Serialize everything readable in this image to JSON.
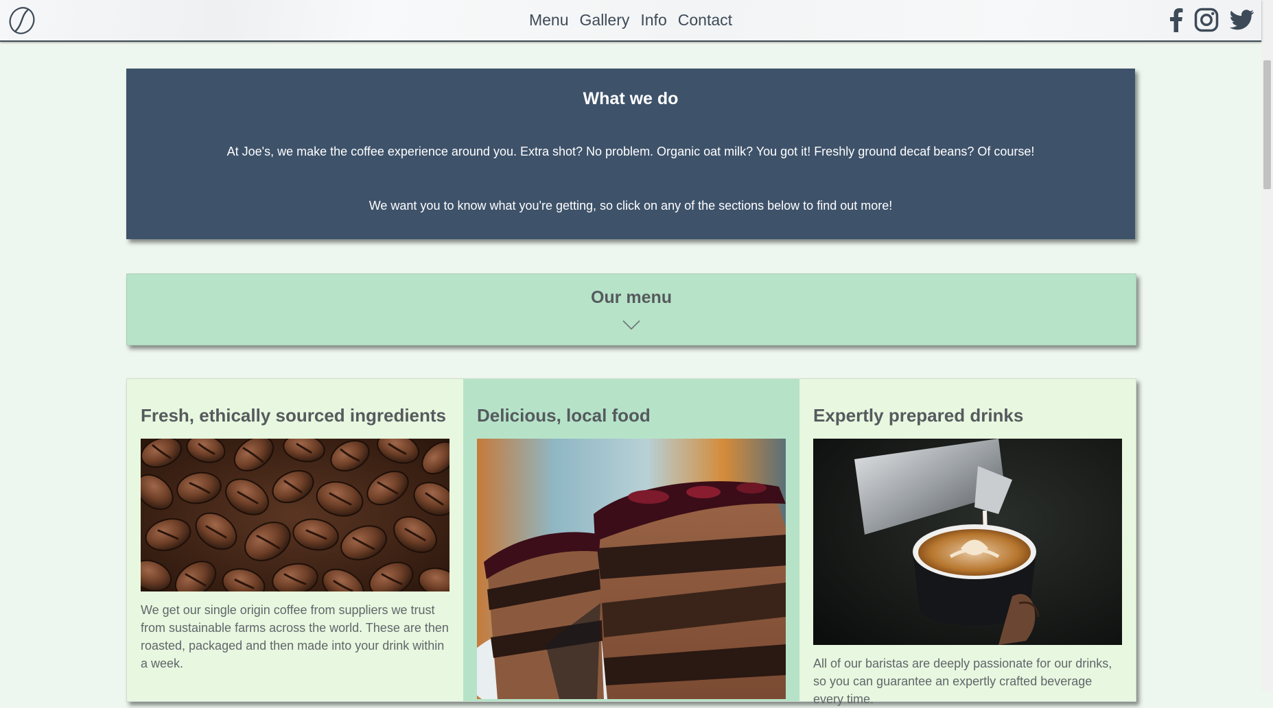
{
  "nav": {
    "logo_icon": "coffee-bean-logo-icon",
    "links": [
      {
        "label": "Menu"
      },
      {
        "label": "Gallery"
      },
      {
        "label": "Info"
      },
      {
        "label": "Contact"
      }
    ],
    "social_icons": [
      "facebook-icon",
      "instagram-icon",
      "twitter-icon"
    ]
  },
  "what_we_do": {
    "title": "What we do",
    "paragraphs": [
      "At Joe's, we make the coffee experience around you. Extra shot? No problem. Organic oat milk? You got it! Freshly ground decaf beans? Of course!",
      "We want you to know what you're getting, so click on any of the sections below to find out more!"
    ]
  },
  "menu_banner": {
    "title": "Our menu",
    "icon": "chevron-down-icon"
  },
  "cards": [
    {
      "title": "Fresh, ethically sourced ingredients",
      "image": "coffee-beans-photo",
      "text": "We get our single origin coffee from suppliers we trust from sustainable farms across the world. These are then roasted, packaged and then made into your drink within a week."
    },
    {
      "title": "Delicious, local food",
      "image": "chocolate-cake-photo",
      "text": ""
    },
    {
      "title": "Expertly prepared drinks",
      "image": "latte-art-photo",
      "text": "All of our baristas are deeply passionate for our drinks, so you can guarantee an expertly crafted beverage every time."
    }
  ],
  "colors": {
    "page_bg": "#eef7ef",
    "header_panel": "#3e526a",
    "mint": "#b6e3c8",
    "light_green": "#e8f7df",
    "text": "#555a5e"
  }
}
